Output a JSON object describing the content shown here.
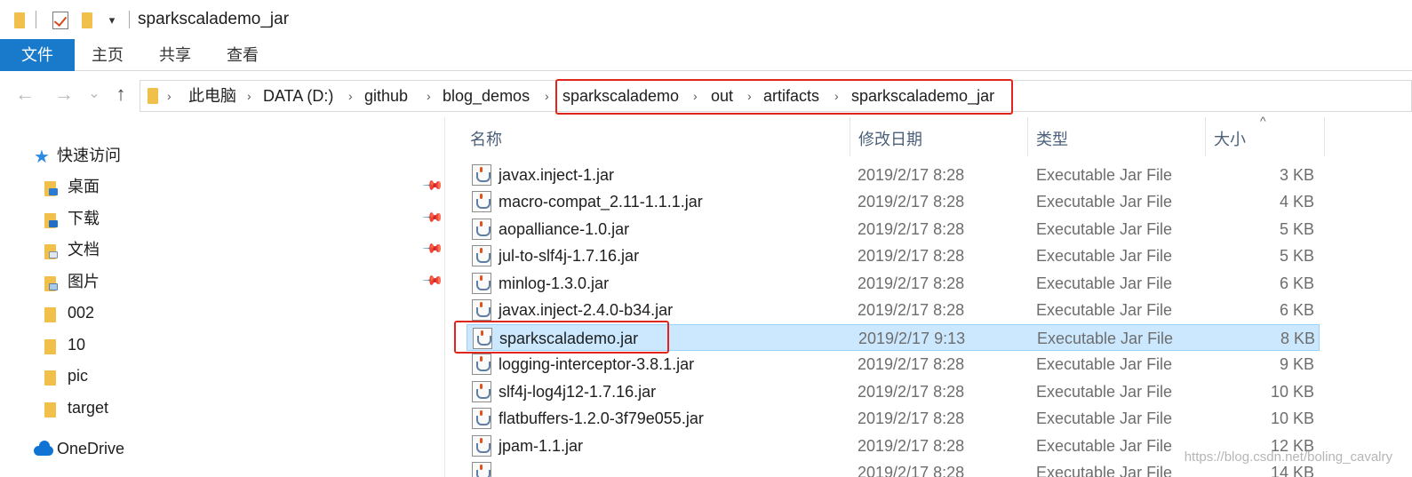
{
  "window": {
    "title": "sparkscalademo_jar"
  },
  "ribbon": {
    "tabs": [
      {
        "label": "文件"
      },
      {
        "label": "主页"
      },
      {
        "label": "共享"
      },
      {
        "label": "查看"
      }
    ]
  },
  "nav_buttons": {
    "back": "←",
    "forward": "→",
    "recent": "⌄",
    "up": "↑"
  },
  "address": {
    "breadcrumbs": [
      "此电脑",
      "DATA (D:)",
      "github",
      "blog_demos",
      "sparkscalademo",
      "out",
      "artifacts",
      "sparkscalademo_jar"
    ]
  },
  "sidebar": {
    "quick_access": "快速访问",
    "items": [
      "桌面",
      "下载",
      "文档",
      "图片",
      "002",
      "10",
      "pic",
      "target"
    ],
    "onedrive": "OneDrive"
  },
  "columns": {
    "name": "名称",
    "date": "修改日期",
    "type": "类型",
    "size": "大小"
  },
  "files": [
    {
      "name": "javax.inject-1.jar",
      "date": "2019/2/17 8:28",
      "type": "Executable Jar File",
      "size": "3 KB"
    },
    {
      "name": "macro-compat_2.11-1.1.1.jar",
      "date": "2019/2/17 8:28",
      "type": "Executable Jar File",
      "size": "4 KB"
    },
    {
      "name": "aopalliance-1.0.jar",
      "date": "2019/2/17 8:28",
      "type": "Executable Jar File",
      "size": "5 KB"
    },
    {
      "name": "jul-to-slf4j-1.7.16.jar",
      "date": "2019/2/17 8:28",
      "type": "Executable Jar File",
      "size": "5 KB"
    },
    {
      "name": "minlog-1.3.0.jar",
      "date": "2019/2/17 8:28",
      "type": "Executable Jar File",
      "size": "6 KB"
    },
    {
      "name": "javax.inject-2.4.0-b34.jar",
      "date": "2019/2/17 8:28",
      "type": "Executable Jar File",
      "size": "6 KB"
    },
    {
      "name": "sparkscalademo.jar",
      "date": "2019/2/17 9:13",
      "type": "Executable Jar File",
      "size": "8 KB"
    },
    {
      "name": "logging-interceptor-3.8.1.jar",
      "date": "2019/2/17 8:28",
      "type": "Executable Jar File",
      "size": "9 KB"
    },
    {
      "name": "slf4j-log4j12-1.7.16.jar",
      "date": "2019/2/17 8:28",
      "type": "Executable Jar File",
      "size": "10 KB"
    },
    {
      "name": "flatbuffers-1.2.0-3f79e055.jar",
      "date": "2019/2/17 8:28",
      "type": "Executable Jar File",
      "size": "10 KB"
    },
    {
      "name": "jpam-1.1.jar",
      "date": "2019/2/17 8:28",
      "type": "Executable Jar File",
      "size": "12 KB"
    },
    {
      "name": "",
      "date": "2019/2/17 8:28",
      "type": "Executable Jar File",
      "size": "14 KB"
    }
  ],
  "watermark": "https://blog.csdn.net/boling_cavalry",
  "colors": {
    "accent": "#1979ca",
    "selection": "#cce8ff",
    "highlight_box": "#e0261c"
  }
}
